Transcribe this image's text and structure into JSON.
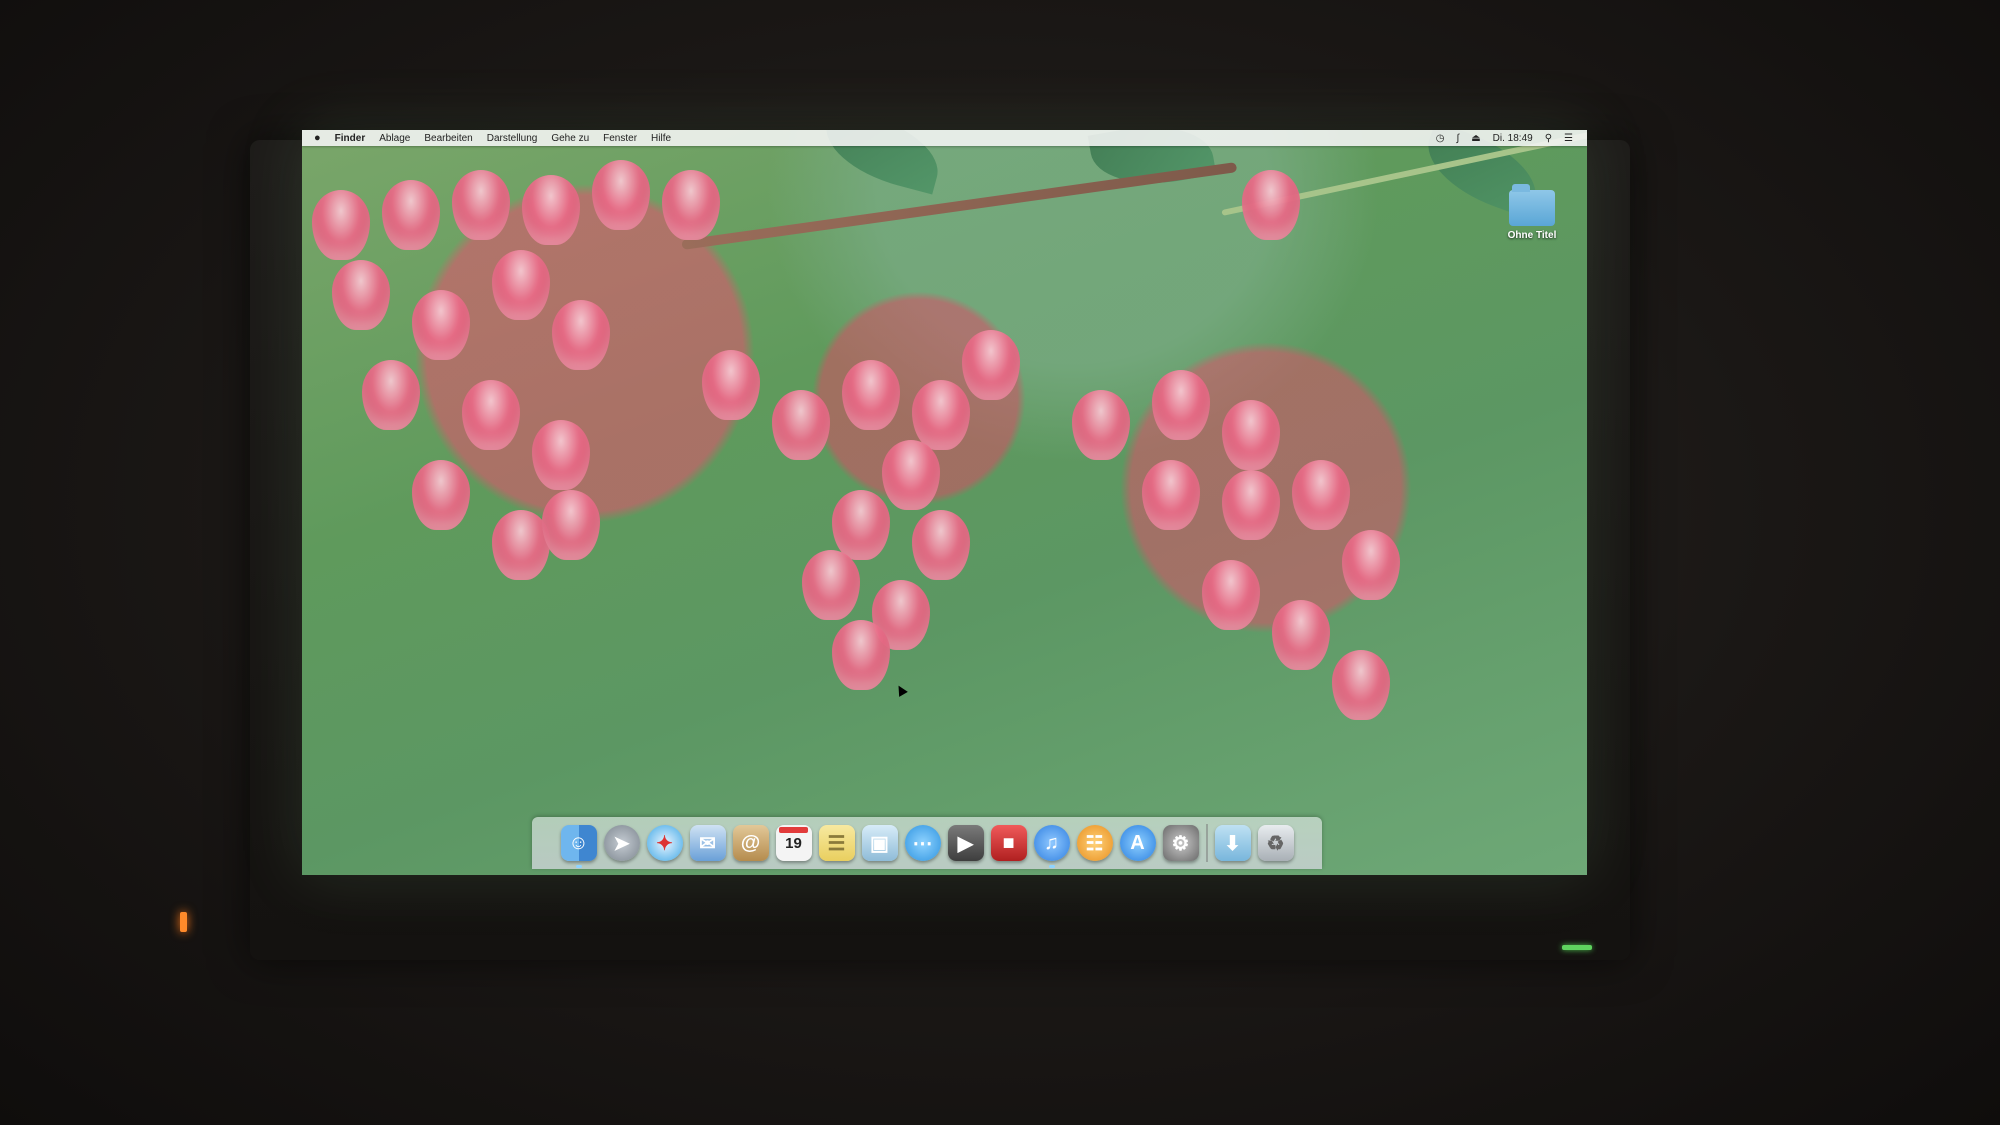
{
  "menubar": {
    "apple": "",
    "items": [
      "Finder",
      "Ablage",
      "Bearbeiten",
      "Darstellung",
      "Gehe zu",
      "Fenster",
      "Hilfe"
    ],
    "status": {
      "time_machine": "time-machine-icon",
      "bluetooth": "bluetooth-icon",
      "eject": "eject-icon",
      "clock": "Di. 18:49",
      "spotlight": "spotlight-icon",
      "notifications": "notification-center-icon"
    }
  },
  "desktop": {
    "folder_label": "Ohne Titel"
  },
  "dock": {
    "calendar_day": "19",
    "items": [
      {
        "name": "finder",
        "color": "#4a90d9"
      },
      {
        "name": "launchpad",
        "color": "#9aa3ad"
      },
      {
        "name": "safari",
        "color": "#3fa8e6"
      },
      {
        "name": "mail",
        "color": "#6aa0d8"
      },
      {
        "name": "contacts",
        "color": "#c8a46b"
      },
      {
        "name": "calendar",
        "color": "#f4f4f4"
      },
      {
        "name": "notes",
        "color": "#f2dd7a"
      },
      {
        "name": "preview",
        "color": "#9cc6e0"
      },
      {
        "name": "messages",
        "color": "#4fb0f0"
      },
      {
        "name": "facetime",
        "color": "#5a5a5a"
      },
      {
        "name": "photo-booth",
        "color": "#d83a3a"
      },
      {
        "name": "itunes",
        "color": "#3d8ff0"
      },
      {
        "name": "ibooks",
        "color": "#f0a030"
      },
      {
        "name": "app-store",
        "color": "#3b8fe8"
      },
      {
        "name": "system-preferences",
        "color": "#8a8a8a"
      },
      {
        "name": "downloads-stack",
        "color": "#9ccbe6"
      },
      {
        "name": "trash",
        "color": "#c9ced2"
      }
    ]
  }
}
